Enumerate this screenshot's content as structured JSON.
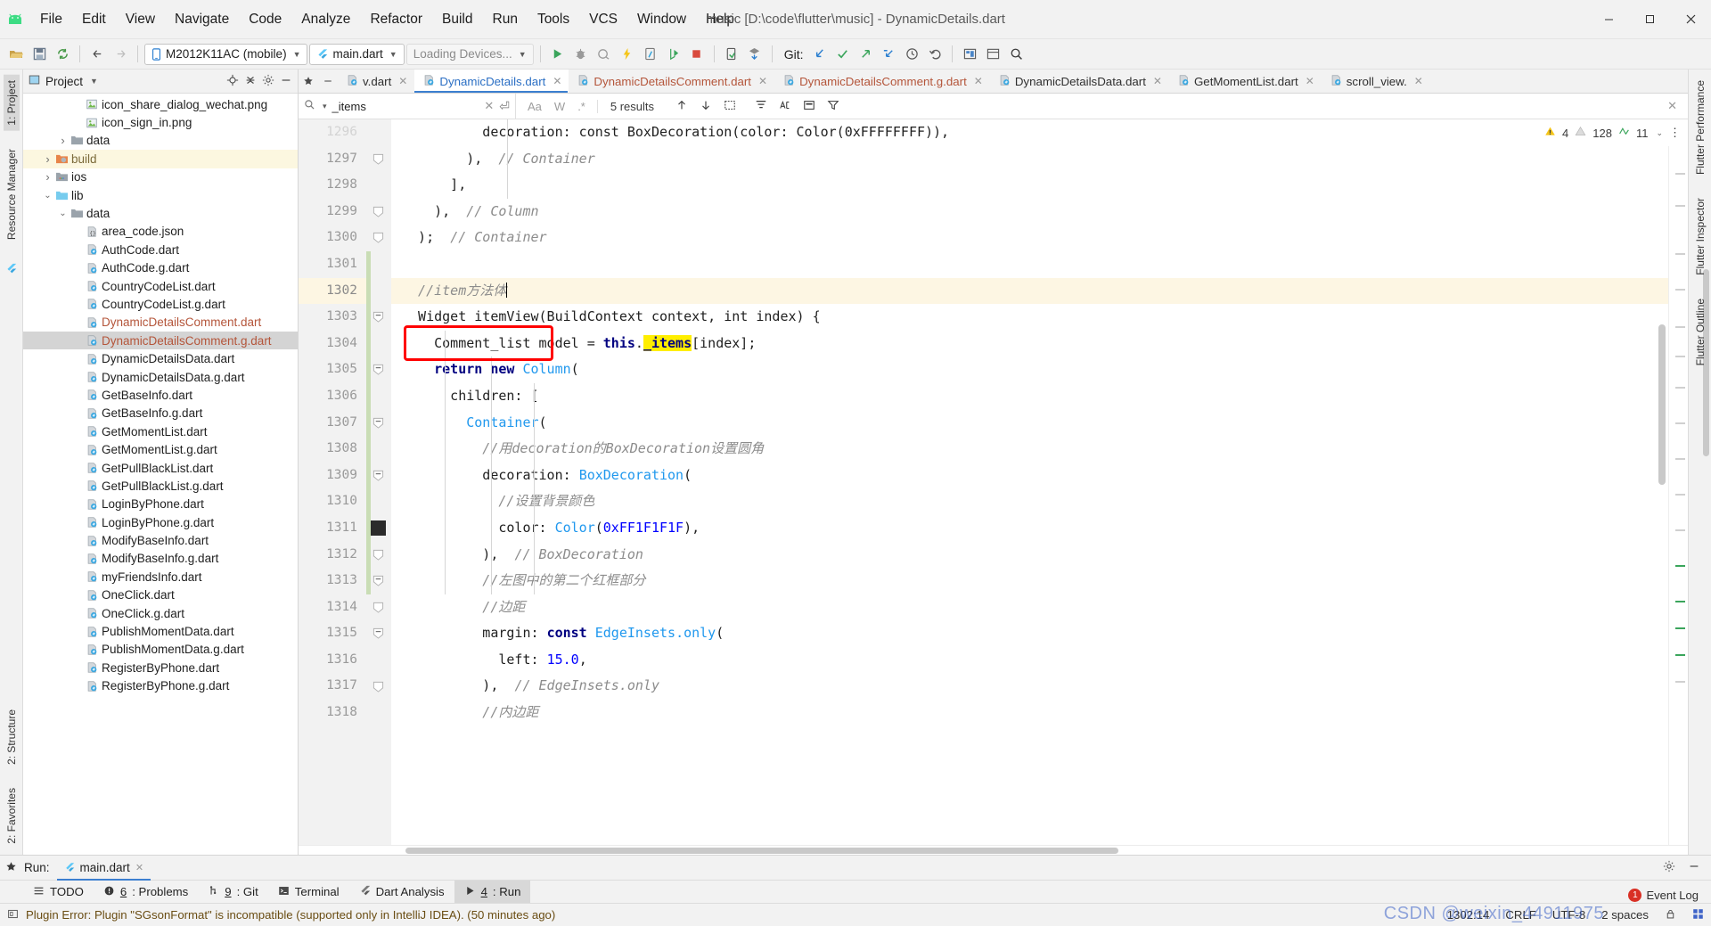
{
  "window": {
    "title": "music [D:\\code\\flutter\\music] - DynamicDetails.dart",
    "minimize": "—",
    "maximize": "❐",
    "close": "✕"
  },
  "menubar": {
    "logo_icon": "android-logo-icon",
    "items": [
      "File",
      "Edit",
      "View",
      "Navigate",
      "Code",
      "Analyze",
      "Refactor",
      "Build",
      "Run",
      "Tools",
      "VCS",
      "Window",
      "Help"
    ]
  },
  "toolbar": {
    "device_combo": "M2012K11AC (mobile)",
    "config_combo": "main.dart",
    "devices_combo": "Loading Devices...",
    "git_label": "Git:",
    "icons": [
      "open-folder-icon",
      "save-icon",
      "sync-icon",
      "back-icon",
      "forward-icon",
      "run-icon",
      "debug-icon",
      "profile-icon",
      "hot-reload-icon",
      "open-device-file-explorer-icon",
      "run-flutter-icon",
      "stop-icon",
      "device-manager-icon",
      "sdk-manager-icon",
      "git-update-icon",
      "git-commit-icon",
      "git-push-icon",
      "git-branch-icon",
      "history-icon",
      "revert-icon",
      "layout-inspector-icon",
      "preview-icon",
      "search-everywhere-icon"
    ]
  },
  "left_rail": {
    "top": [
      "1: Project"
    ],
    "middle": [
      "Resource Manager"
    ],
    "bottom": [
      "2: Structure",
      "2: Favorites"
    ]
  },
  "right_rail": {
    "items": [
      "Flutter Performance",
      "Flutter Inspector",
      "Flutter Outline"
    ]
  },
  "project_panel": {
    "title": "Project",
    "header_icons": [
      "locate-icon",
      "collapse-all-icon",
      "settings-icon",
      "hide-icon"
    ],
    "tree": [
      {
        "indent": 4,
        "icon": "image-file-icon",
        "label": "icon_share_dialog_wechat.png",
        "style": "dart",
        "arrow": ""
      },
      {
        "indent": 4,
        "icon": "image-file-icon",
        "label": "icon_sign_in.png",
        "style": "dart",
        "arrow": ""
      },
      {
        "indent": 3,
        "icon": "folder-icon",
        "label": "data",
        "style": "folder",
        "arrow": "collapsed"
      },
      {
        "indent": 2,
        "icon": "build-folder-icon",
        "label": "build",
        "style": "build",
        "arrow": "collapsed",
        "row": "hl"
      },
      {
        "indent": 2,
        "icon": "ios-folder-icon",
        "label": "ios",
        "style": "folder",
        "arrow": "collapsed"
      },
      {
        "indent": 2,
        "icon": "lib-folder-icon",
        "label": "lib",
        "style": "folder",
        "arrow": "expanded"
      },
      {
        "indent": 3,
        "icon": "folder-icon",
        "label": "data",
        "style": "folder",
        "arrow": "expanded"
      },
      {
        "indent": 4,
        "icon": "json-file-icon",
        "label": "area_code.json",
        "style": "dart",
        "arrow": ""
      },
      {
        "indent": 4,
        "icon": "dart-file-icon",
        "label": "AuthCode.dart",
        "style": "dart",
        "arrow": ""
      },
      {
        "indent": 4,
        "icon": "dart-file-icon",
        "label": "AuthCode.g.dart",
        "style": "dart",
        "arrow": ""
      },
      {
        "indent": 4,
        "icon": "dart-file-icon",
        "label": "CountryCodeList.dart",
        "style": "dart",
        "arrow": ""
      },
      {
        "indent": 4,
        "icon": "dart-file-icon",
        "label": "CountryCodeList.g.dart",
        "style": "dart",
        "arrow": ""
      },
      {
        "indent": 4,
        "icon": "dart-file-icon",
        "label": "DynamicDetailsComment.dart",
        "style": "mod",
        "arrow": ""
      },
      {
        "indent": 4,
        "icon": "dart-file-icon",
        "label": "DynamicDetailsComment.g.dart",
        "style": "mod",
        "arrow": "",
        "row": "sel"
      },
      {
        "indent": 4,
        "icon": "dart-file-icon",
        "label": "DynamicDetailsData.dart",
        "style": "dart",
        "arrow": ""
      },
      {
        "indent": 4,
        "icon": "dart-file-icon",
        "label": "DynamicDetailsData.g.dart",
        "style": "dart",
        "arrow": ""
      },
      {
        "indent": 4,
        "icon": "dart-file-icon",
        "label": "GetBaseInfo.dart",
        "style": "dart",
        "arrow": ""
      },
      {
        "indent": 4,
        "icon": "dart-file-icon",
        "label": "GetBaseInfo.g.dart",
        "style": "dart",
        "arrow": ""
      },
      {
        "indent": 4,
        "icon": "dart-file-icon",
        "label": "GetMomentList.dart",
        "style": "dart",
        "arrow": ""
      },
      {
        "indent": 4,
        "icon": "dart-file-icon",
        "label": "GetMomentList.g.dart",
        "style": "dart",
        "arrow": ""
      },
      {
        "indent": 4,
        "icon": "dart-file-icon",
        "label": "GetPullBlackList.dart",
        "style": "dart",
        "arrow": ""
      },
      {
        "indent": 4,
        "icon": "dart-file-icon",
        "label": "GetPullBlackList.g.dart",
        "style": "dart",
        "arrow": ""
      },
      {
        "indent": 4,
        "icon": "dart-file-icon",
        "label": "LoginByPhone.dart",
        "style": "dart",
        "arrow": ""
      },
      {
        "indent": 4,
        "icon": "dart-file-icon",
        "label": "LoginByPhone.g.dart",
        "style": "dart",
        "arrow": ""
      },
      {
        "indent": 4,
        "icon": "dart-file-icon",
        "label": "ModifyBaseInfo.dart",
        "style": "dart",
        "arrow": ""
      },
      {
        "indent": 4,
        "icon": "dart-file-icon",
        "label": "ModifyBaseInfo.g.dart",
        "style": "dart",
        "arrow": ""
      },
      {
        "indent": 4,
        "icon": "dart-file-icon",
        "label": "myFriendsInfo.dart",
        "style": "dart",
        "arrow": ""
      },
      {
        "indent": 4,
        "icon": "dart-file-icon",
        "label": "OneClick.dart",
        "style": "dart",
        "arrow": ""
      },
      {
        "indent": 4,
        "icon": "dart-file-icon",
        "label": "OneClick.g.dart",
        "style": "dart",
        "arrow": ""
      },
      {
        "indent": 4,
        "icon": "dart-file-icon",
        "label": "PublishMomentData.dart",
        "style": "dart",
        "arrow": ""
      },
      {
        "indent": 4,
        "icon": "dart-file-icon",
        "label": "PublishMomentData.g.dart",
        "style": "dart",
        "arrow": ""
      },
      {
        "indent": 4,
        "icon": "dart-file-icon",
        "label": "RegisterByPhone.dart",
        "style": "dart",
        "arrow": ""
      },
      {
        "indent": 4,
        "icon": "dart-file-icon",
        "label": "RegisterByPhone.g.dart",
        "style": "dart",
        "arrow": ""
      }
    ]
  },
  "editor_tabs": [
    {
      "label": "v.dart",
      "state": "plain",
      "icon": "dart-file-icon"
    },
    {
      "label": "DynamicDetails.dart",
      "state": "active",
      "icon": "dart-file-icon"
    },
    {
      "label": "DynamicDetailsComment.dart",
      "state": "modified",
      "icon": "dart-file-icon"
    },
    {
      "label": "DynamicDetailsComment.g.dart",
      "state": "modified",
      "icon": "dart-file-icon"
    },
    {
      "label": "DynamicDetailsData.dart",
      "state": "plain",
      "icon": "dart-file-icon"
    },
    {
      "label": "GetMomentList.dart",
      "state": "plain",
      "icon": "dart-file-icon"
    },
    {
      "label": "scroll_view.",
      "state": "plain",
      "icon": "dart-file-icon"
    }
  ],
  "find": {
    "query": "_items",
    "search_icon": "search-icon",
    "clear_icon": "close-icon",
    "regex_return_icon": "multiline-icon",
    "match_case": "Aa",
    "words": "W",
    "regex": ".*",
    "results": "5 results",
    "prev_icon": "arrow-up-icon",
    "next_icon": "arrow-down-icon",
    "select_all_icon": "select-all-icon",
    "actions": [
      "filter-icon",
      "preserve-case-icon",
      "in-selection-icon"
    ]
  },
  "inspections": {
    "warnings": "4",
    "weak_warnings": "128",
    "typos": "11",
    "warning_icon": "warning-triangle-icon",
    "weak_icon": "weak-warning-icon",
    "typo_icon": "typo-icon",
    "chevron_icon": "chevron-down-icon",
    "more_icon": "more-icon"
  },
  "code": {
    "first_line": 1297,
    "caret_line": 1302,
    "lines": [
      {
        "n": 1296,
        "cut": true,
        "tokens": [
          {
            "t": "          decoration: const BoxDecoration(color: Color(0xFFFFFFFF)),",
            "c": "plain"
          }
        ]
      },
      {
        "n": 1297,
        "fold": "end",
        "tokens": [
          {
            "t": "        ),  ",
            "c": "plain"
          },
          {
            "t": "// Container",
            "c": "cm"
          }
        ]
      },
      {
        "n": 1298,
        "tokens": [
          {
            "t": "      ],",
            "c": "plain"
          }
        ]
      },
      {
        "n": 1299,
        "fold": "end",
        "tokens": [
          {
            "t": "    ),  ",
            "c": "plain"
          },
          {
            "t": "// Column",
            "c": "cm"
          }
        ]
      },
      {
        "n": 1300,
        "fold": "end",
        "tokens": [
          {
            "t": "  );  ",
            "c": "plain"
          },
          {
            "t": "// Container",
            "c": "cm"
          }
        ]
      },
      {
        "n": 1301,
        "tokens": [
          {
            "t": "",
            "c": "plain"
          }
        ]
      },
      {
        "n": 1302,
        "current": true,
        "tokens": [
          {
            "t": "  //item方法体",
            "c": "cm"
          }
        ]
      },
      {
        "n": 1303,
        "fold": "start",
        "tokens": [
          {
            "t": "  Widget itemView(BuildContext context, int index) {",
            "c": "plain"
          }
        ]
      },
      {
        "n": 1304,
        "boxed": true,
        "tokens": [
          {
            "t": "    Comment_list",
            "c": "plain"
          },
          {
            "t": " model = ",
            "c": "plain"
          },
          {
            "t": "this",
            "c": "kw"
          },
          {
            "t": ".",
            "c": "plain"
          },
          {
            "t": "_items",
            "c": "hlmatch"
          },
          {
            "t": "[index];",
            "c": "plain"
          }
        ]
      },
      {
        "n": 1305,
        "fold": "start",
        "tokens": [
          {
            "t": "    return new ",
            "c": "kw"
          },
          {
            "t": "Column",
            "c": "cls"
          },
          {
            "t": "(",
            "c": "plain"
          }
        ]
      },
      {
        "n": 1306,
        "tokens": [
          {
            "t": "      children: [",
            "c": "plain"
          }
        ]
      },
      {
        "n": 1307,
        "fold": "start",
        "tokens": [
          {
            "t": "        ",
            "c": "plain"
          },
          {
            "t": "Container",
            "c": "cls"
          },
          {
            "t": "(",
            "c": "plain"
          }
        ]
      },
      {
        "n": 1308,
        "tokens": [
          {
            "t": "          //用decoration的BoxDecoration设置圆角",
            "c": "cm"
          }
        ]
      },
      {
        "n": 1309,
        "fold": "start",
        "tokens": [
          {
            "t": "          decoration: ",
            "c": "plain"
          },
          {
            "t": "BoxDecoration",
            "c": "cls"
          },
          {
            "t": "(",
            "c": "plain"
          }
        ]
      },
      {
        "n": 1310,
        "tokens": [
          {
            "t": "            //设置背景颜色",
            "c": "cm"
          }
        ]
      },
      {
        "n": 1311,
        "bookmark": true,
        "tokens": [
          {
            "t": "            color: ",
            "c": "plain"
          },
          {
            "t": "Color",
            "c": "cls"
          },
          {
            "t": "(",
            "c": "plain"
          },
          {
            "t": "0xFF1F1F1F",
            "c": "num"
          },
          {
            "t": "),",
            "c": "plain"
          }
        ]
      },
      {
        "n": 1312,
        "fold": "end",
        "tokens": [
          {
            "t": "          ),  ",
            "c": "plain"
          },
          {
            "t": "// BoxDecoration",
            "c": "cm"
          }
        ]
      },
      {
        "n": 1313,
        "fold": "start",
        "tokens": [
          {
            "t": "          //左图中的第二个红框部分",
            "c": "cm"
          }
        ]
      },
      {
        "n": 1314,
        "fold": "end",
        "tokens": [
          {
            "t": "          //边距",
            "c": "cm"
          }
        ]
      },
      {
        "n": 1315,
        "fold": "start",
        "tokens": [
          {
            "t": "          margin: ",
            "c": "plain"
          },
          {
            "t": "const ",
            "c": "kw"
          },
          {
            "t": "EdgeInsets",
            "c": "cls"
          },
          {
            "t": ".only",
            "c": "cls"
          },
          {
            "t": "(",
            "c": "plain"
          }
        ]
      },
      {
        "n": 1316,
        "tokens": [
          {
            "t": "            left: ",
            "c": "plain"
          },
          {
            "t": "15.0",
            "c": "num"
          },
          {
            "t": ",",
            "c": "plain"
          }
        ]
      },
      {
        "n": 1317,
        "fold": "end",
        "tokens": [
          {
            "t": "          ),  ",
            "c": "plain"
          },
          {
            "t": "// EdgeInsets.only",
            "c": "cm"
          }
        ]
      },
      {
        "n": 1318,
        "cut": true,
        "tokens": [
          {
            "t": "          //内边距",
            "c": "cm"
          }
        ]
      }
    ]
  },
  "run_panel": {
    "label": "Run:",
    "tab": "main.dart",
    "tab_icon": "flutter-icon",
    "close_icon": "close-icon",
    "settings_icon": "gear-icon",
    "hide_icon": "minimize-icon"
  },
  "tool_windows": [
    {
      "label": "TODO",
      "icon": "todo-icon",
      "num": "",
      "active": false
    },
    {
      "label": ": Problems",
      "icon": "problems-icon",
      "num": "6",
      "active": false
    },
    {
      "label": ": Git",
      "icon": "git-icon",
      "num": "9",
      "active": false
    },
    {
      "label": "Terminal",
      "icon": "terminal-icon",
      "num": "",
      "active": false
    },
    {
      "label": "Dart Analysis",
      "icon": "dart-icon",
      "num": "",
      "active": false
    },
    {
      "label": ": Run",
      "icon": "run-icon",
      "num": "4",
      "active": true
    }
  ],
  "statusbar": {
    "icon": "message-icon",
    "message": "Plugin Error: Plugin \"SGsonFormat\" is incompatible (supported only in IntelliJ IDEA). (50 minutes ago)",
    "position": "1302:14",
    "line_separator": "CRLF",
    "encoding": "UTF-8",
    "indent": "2 spaces",
    "lock_icon": "lock-icon",
    "event_log": "Event Log",
    "event_count": "1",
    "watermark": "CSDN @weixin_44911975"
  },
  "colors": {
    "accent": "#3c7fd0",
    "modified_tab": "#b4553a",
    "keyword": "#000080",
    "class": "#2098ee",
    "number": "#0000ff",
    "comment": "#8c8c8c",
    "highlight": "#ffee00",
    "redbox": "#ff0000",
    "current_line": "#fdf6e3"
  }
}
